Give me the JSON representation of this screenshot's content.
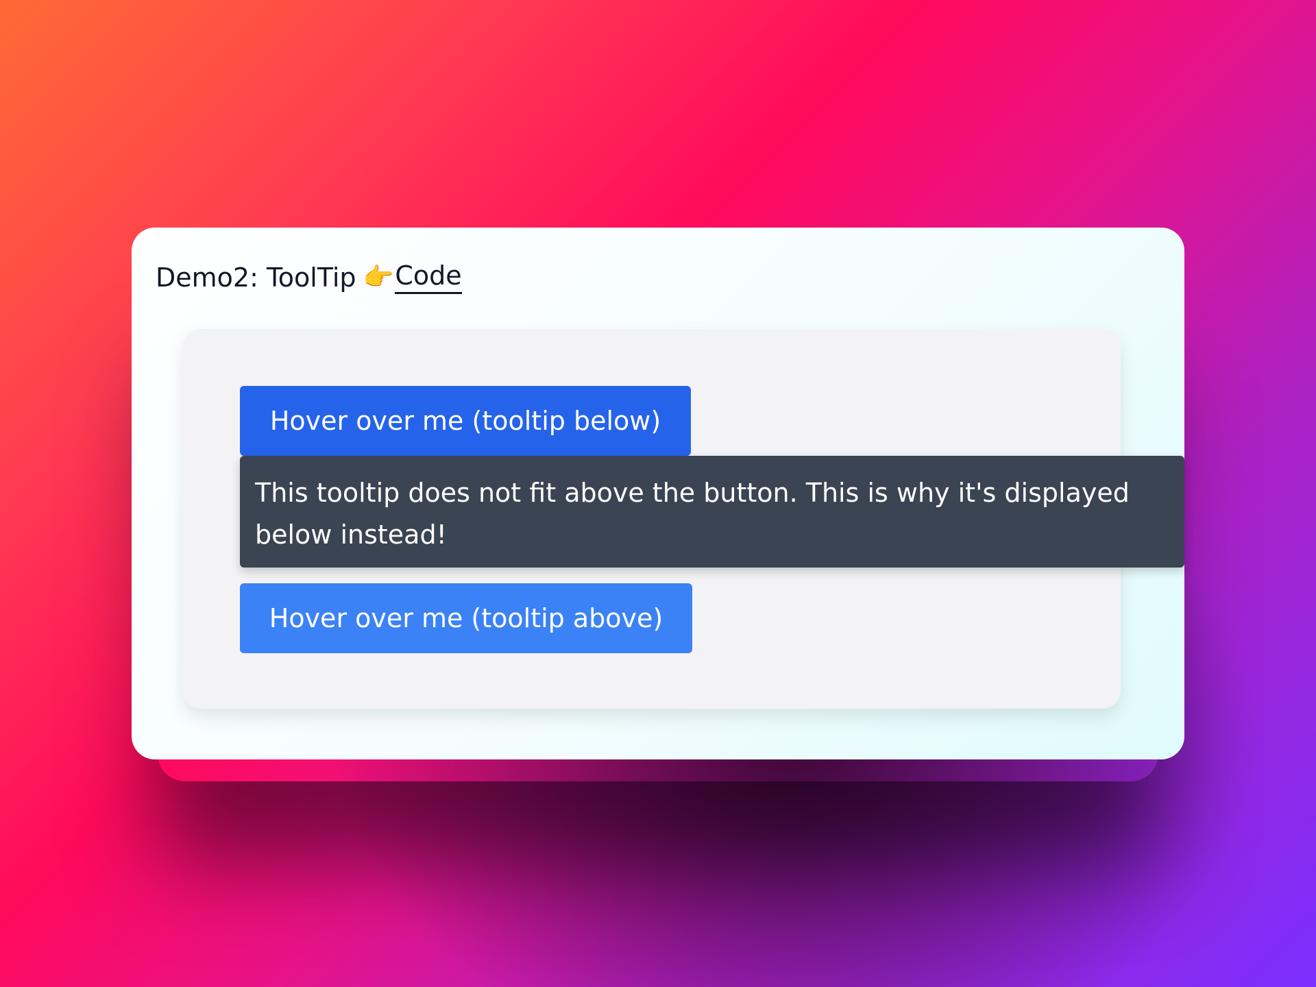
{
  "card": {
    "title": "Demo2: ToolTip",
    "pointer_icon": "👉",
    "code_link": "Code"
  },
  "buttons": {
    "below_label": "Hover over me (tooltip below)",
    "above_label": "Hover over me (tooltip above)"
  },
  "tooltip": {
    "text": "This tooltip does not fit above the button. This is why it's displayed below instead!"
  },
  "colors": {
    "button_below": "#2563eb",
    "button_above": "#3b82f6",
    "tooltip_bg": "#3b4453",
    "panel_bg": "#f3f3f5"
  },
  "icons": {
    "pointer": "backhand-index-pointing-right-icon"
  }
}
